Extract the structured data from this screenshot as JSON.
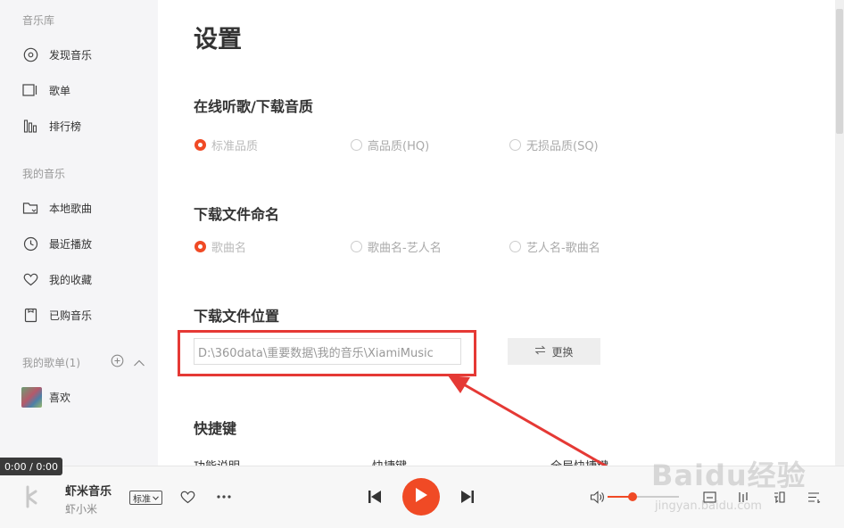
{
  "sidebar": {
    "section_library": "音乐库",
    "section_my_music": "我的音乐",
    "library_items": [
      {
        "label": "发现音乐",
        "icon": "disc-icon"
      },
      {
        "label": "歌单",
        "icon": "playlist-icon"
      },
      {
        "label": "排行榜",
        "icon": "chart-icon"
      }
    ],
    "my_items": [
      {
        "label": "本地歌曲",
        "icon": "folder-icon"
      },
      {
        "label": "最近播放",
        "icon": "clock-icon"
      },
      {
        "label": "我的收藏",
        "icon": "heart-icon"
      },
      {
        "label": "已购音乐",
        "icon": "purchased-icon"
      }
    ],
    "my_playlists_label": "我的歌单(1)",
    "playlists": [
      {
        "label": "喜欢"
      }
    ]
  },
  "settings": {
    "title": "设置",
    "quality": {
      "heading": "在线听歌/下载音质",
      "options": [
        "标准品质",
        "高品质(HQ)",
        "无损品质(SQ)"
      ],
      "selected": "标准品质"
    },
    "naming": {
      "heading": "下载文件命名",
      "options": [
        "歌曲名",
        "歌曲名-艺人名",
        "艺人名-歌曲名"
      ],
      "selected": "歌曲名"
    },
    "location": {
      "heading": "下载文件位置",
      "path": "D:\\360data\\重要数据\\我的音乐\\XiamiMusic",
      "change_label": "更换"
    },
    "shortcuts": {
      "heading": "快捷键",
      "columns": [
        "功能说明",
        "快捷键",
        "全局快捷键"
      ]
    }
  },
  "player": {
    "time": "0:00 / 0:00",
    "song_title": "虾米音乐",
    "artist": "虾小米",
    "quality_label": "标准",
    "volume": 0.35
  },
  "watermark": {
    "text": "Baidu经验",
    "sub": "jingyan.baidu.com"
  },
  "colors": {
    "accent": "#f04a25",
    "annotation": "#e53935",
    "sidebar_bg": "#f5f5f7"
  }
}
